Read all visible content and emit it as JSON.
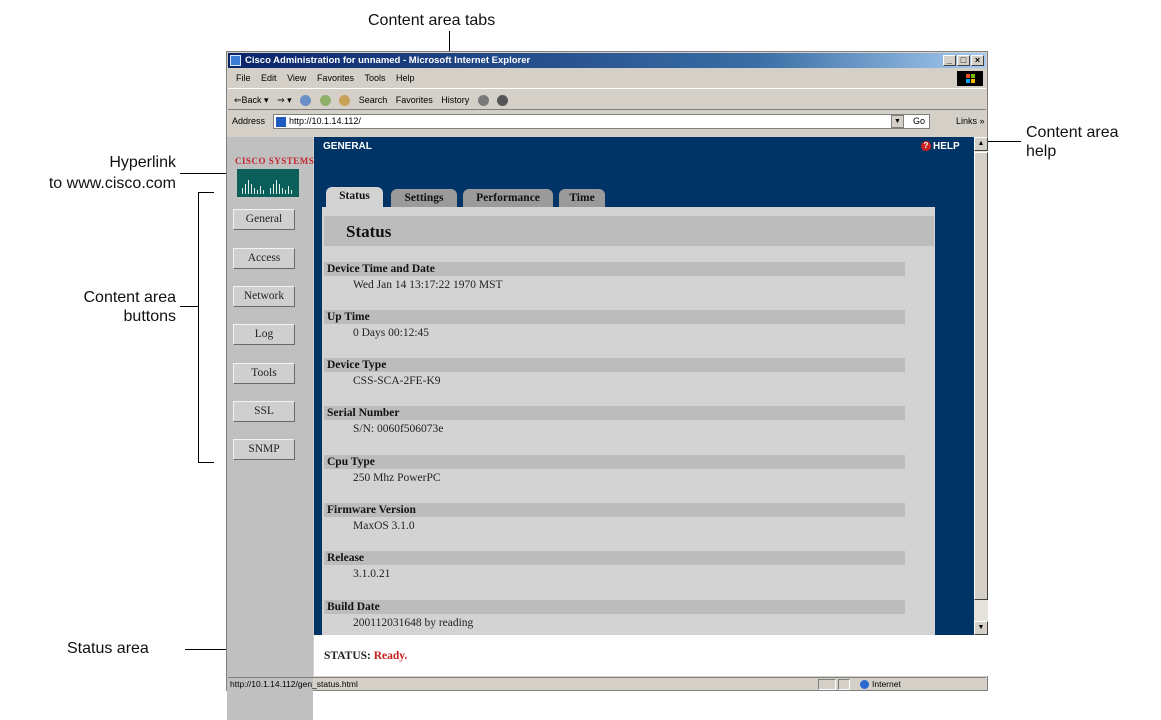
{
  "annotations": {
    "content_area_tabs": "Content area tabs",
    "hyperlink_line1": "Hyperlink",
    "hyperlink_line2": "to www.cisco.com",
    "content_area_buttons_line1": "Content area",
    "content_area_buttons_line2": "buttons",
    "content_area_help_line1": "Content area",
    "content_area_help_line2": "help",
    "status_area": "Status area"
  },
  "window": {
    "title": "Cisco Administration for unnamed - Microsoft Internet Explorer",
    "controls": [
      "_",
      "□",
      "×"
    ]
  },
  "menubar": [
    "File",
    "Edit",
    "View",
    "Favorites",
    "Tools",
    "Help"
  ],
  "toolbar": [
    "⇐Back ▾",
    "⇒ ▾",
    "Search",
    "Favorites",
    "History"
  ],
  "address": {
    "label": "Address",
    "url": "http://10.1.14.112/",
    "go": "Go",
    "links": "Links »"
  },
  "logo": {
    "text": "CISCO SYSTEMS"
  },
  "nav_buttons": [
    "General",
    "Access",
    "Network",
    "Log",
    "Tools",
    "SSL",
    "SNMP"
  ],
  "header": {
    "section": "GENERAL",
    "help": "HELP"
  },
  "tabs": [
    "Status",
    "Settings",
    "Performance",
    "Time"
  ],
  "content": {
    "title": "Status",
    "fields": [
      {
        "label": "Device Time and Date",
        "value": "Wed Jan 14 13:17:22 1970 MST"
      },
      {
        "label": "Up Time",
        "value": "0 Days 00:12:45"
      },
      {
        "label": "Device Type",
        "value": "CSS-SCA-2FE-K9"
      },
      {
        "label": "Serial Number",
        "value": "S/N: 0060f506073e"
      },
      {
        "label": "Cpu Type",
        "value": "250 Mhz PowerPC"
      },
      {
        "label": "Firmware Version",
        "value": "MaxOS 3.1.0"
      },
      {
        "label": "Release",
        "value": "3.1.0.21"
      },
      {
        "label": "Build Date",
        "value": "200112031648 by reading"
      }
    ]
  },
  "status": {
    "label": "STATUS:",
    "value": "Ready."
  },
  "ie_status": {
    "url": "http://10.1.14.112/gen_status.html",
    "zone": "Internet"
  }
}
